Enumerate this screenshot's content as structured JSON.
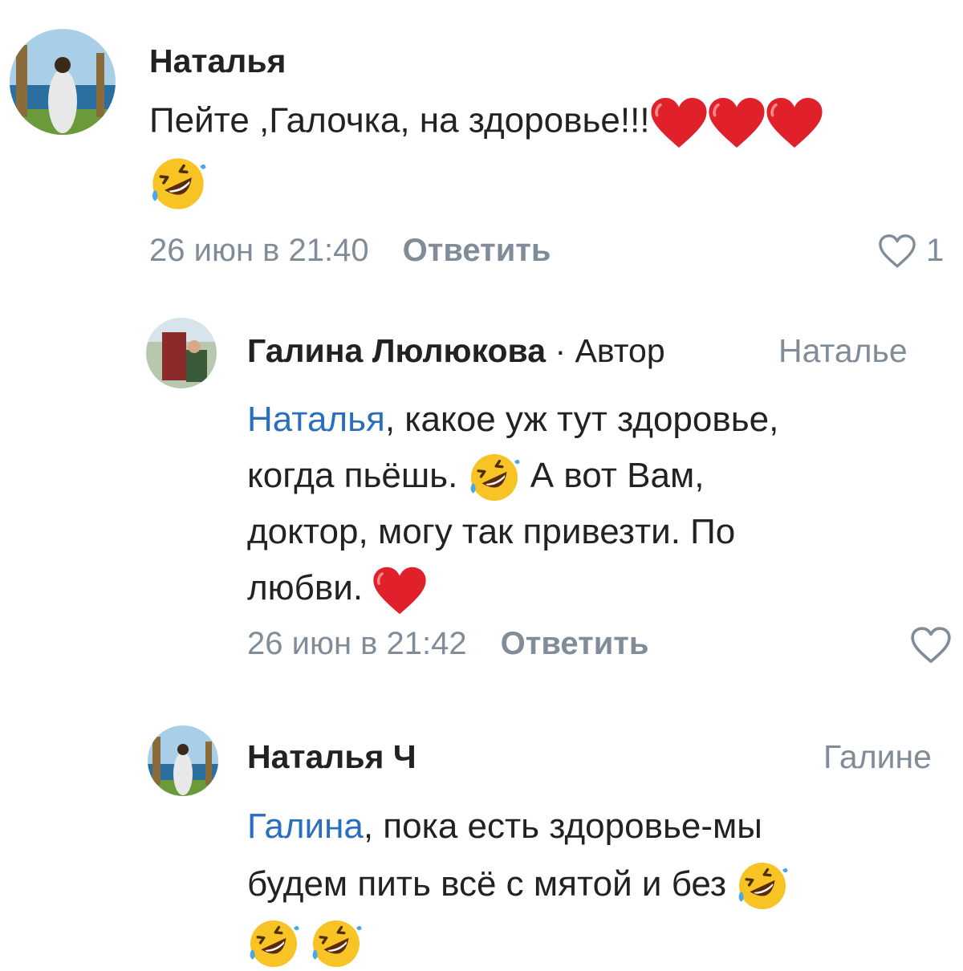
{
  "comments": [
    {
      "author": "Наталья",
      "text": "Пейте ,Галочка, на здоровье!!!",
      "date": "26 июн в 21:40",
      "reply_label": "Ответить",
      "likes": "1"
    },
    {
      "author": "Галина Люлюкова",
      "badge": "· Автор",
      "reply_to": "Наталье",
      "mention": "Наталья",
      "text_1": ", какое уж тут здоровье,",
      "text_2": "когда пьёшь.",
      "text_3": "А вот Вам,",
      "text_4": "доктор, могу так привезти. По",
      "text_5": "любви.",
      "date": "26 июн в 21:42",
      "reply_label": "Ответить"
    },
    {
      "author": "Наталья Ч",
      "reply_to": "Галине",
      "mention": "Галина",
      "text_1": ", пока есть здоровье-мы",
      "text_2": "будем пить всё с мятой и без"
    }
  ],
  "icons": {
    "heart_emoji": "red-heart",
    "laugh_emoji": "rolling-on-floor-laughing",
    "like": "heart-outline"
  },
  "colors": {
    "mention": "#2a6fbd",
    "secondary": "#818c99",
    "heart": "#e0202a",
    "emoji_face": "#f7c325"
  }
}
